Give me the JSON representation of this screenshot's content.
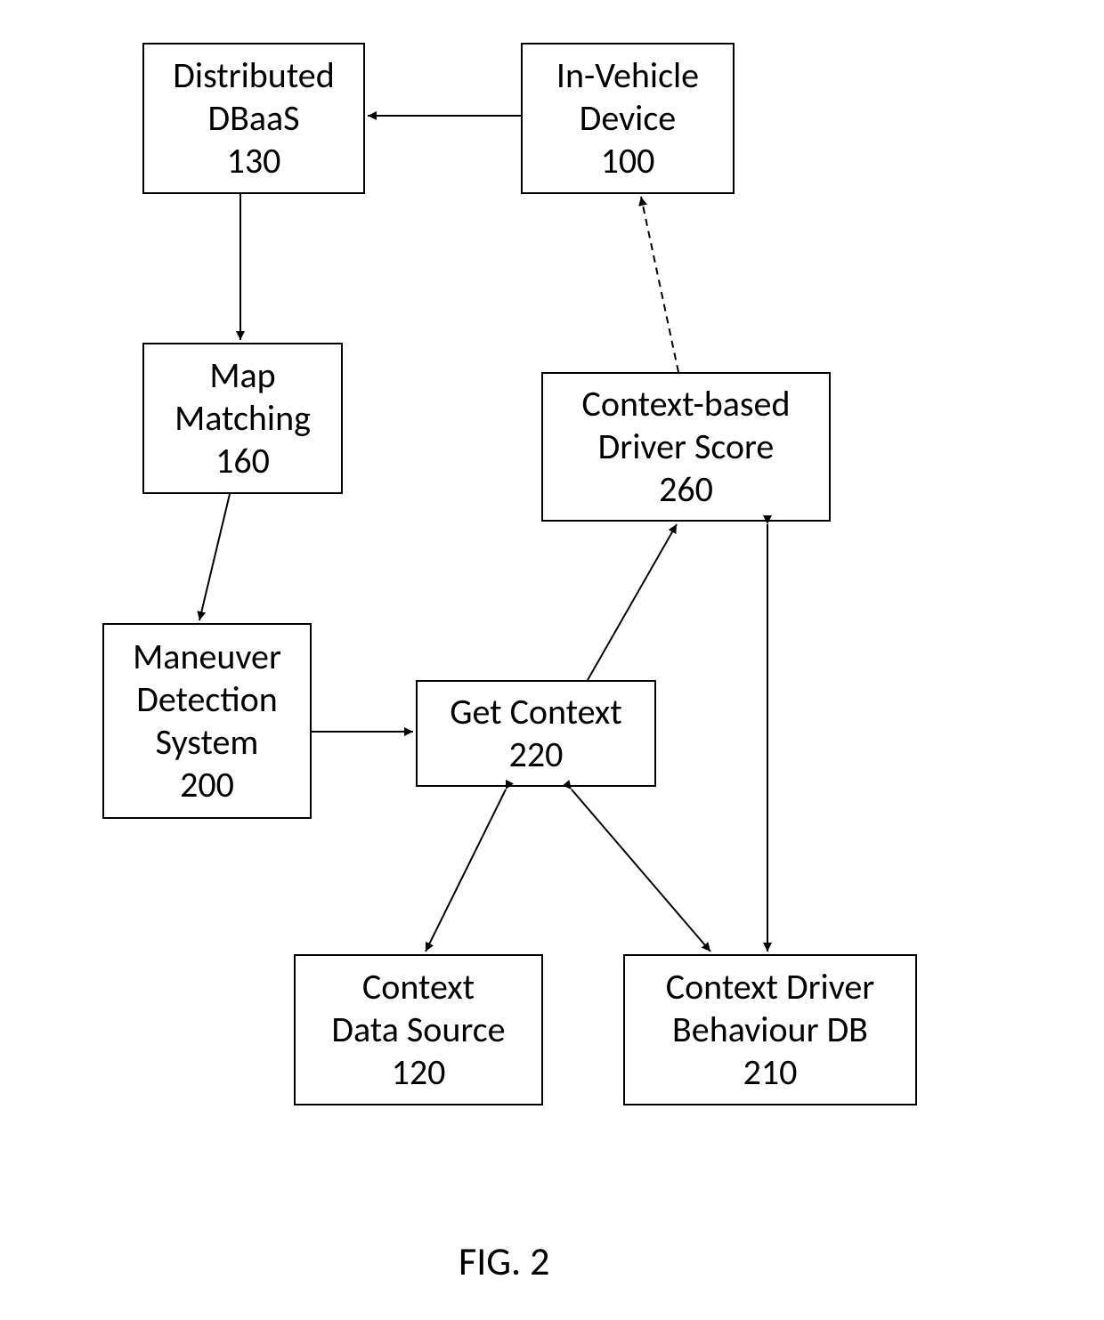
{
  "nodes": {
    "dbaas": {
      "l1": "Distributed",
      "l2": "DBaaS",
      "num": "130"
    },
    "device": {
      "l1": "In-Vehicle",
      "l2": "Device",
      "num": "100"
    },
    "map": {
      "l1": "Map",
      "l2": "Matching",
      "num": "160"
    },
    "score": {
      "l1": "Context-based",
      "l2": "Driver Score",
      "num": "260"
    },
    "maneuver": {
      "l1": "Maneuver",
      "l2": "Detection",
      "l3": "System",
      "num": "200"
    },
    "getctx": {
      "l1": "Get Context",
      "num": "220"
    },
    "ctxsrc": {
      "l1": "Context",
      "l2": "Data Source",
      "num": "120"
    },
    "ctxdb": {
      "l1": "Context Driver",
      "l2": "Behaviour DB",
      "num": "210"
    }
  },
  "caption": "FIG. 2"
}
